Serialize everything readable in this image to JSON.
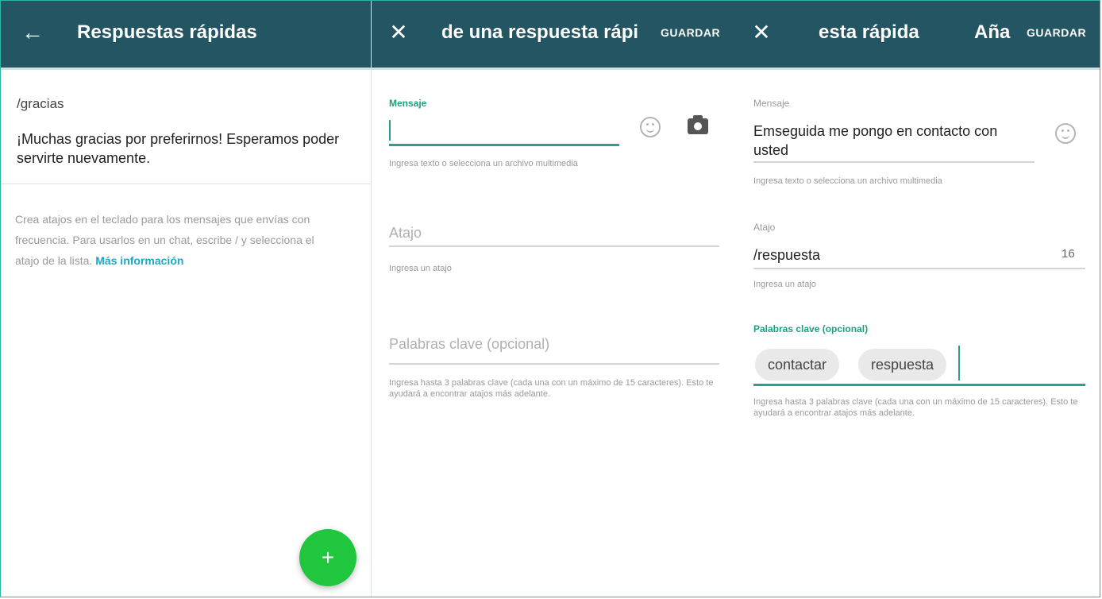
{
  "list_panel": {
    "back_icon": "arrow-left-icon",
    "title": "Respuestas rápidas",
    "item": {
      "shortcut": "/gracias",
      "message": "¡Muchas gracias por preferirnos! Esperamos poder servirte nuevamente."
    },
    "info_text": "Crea atajos en el teclado para los mensajes que envías con frecuencia. Para usarlos en un chat, escribe / y selecciona el atajo de la lista.",
    "info_link": "Más información",
    "fab_label": "+"
  },
  "add_panel": {
    "close_icon": "close-icon",
    "title": "de una respuesta rápi",
    "save_label": "GUARDAR",
    "message_label": "Mensaje",
    "message_helper": "Ingresa texto o selecciona un archivo multimedia",
    "shortcut_placeholder": "Atajo",
    "shortcut_helper": "Ingresa un atajo",
    "keywords_placeholder": "Palabras clave (opcional)",
    "keywords_helper": "Ingresa hasta 3 palabras clave (cada una con un máximo de 15 caracteres). Esto te ayudará a encontrar atajos más adelante."
  },
  "edit_panel": {
    "close_icon": "close-icon",
    "title": "esta rápida",
    "title_extra": "Aña",
    "save_label": "GUARDAR",
    "message_label": "Mensaje",
    "message_value": "Emseguida me pongo en contacto con usted",
    "message_helper": "Ingresa texto o selecciona un archivo multimedia",
    "shortcut_label": "Atajo",
    "shortcut_value": "respuesta",
    "shortcut_counter": "16",
    "shortcut_helper": "Ingresa un atajo",
    "keywords_label": "Palabras clave (opcional)",
    "keywords": [
      "contactar",
      "respuesta"
    ],
    "keywords_helper": "Ingresa hasta 3 palabras clave (cada una con un máximo de 15 caracteres). Esto te ayudará a encontrar atajos más adelante."
  },
  "colors": {
    "appbar": "#235563",
    "accent": "#2f9e8c",
    "fab": "#20c63e",
    "link": "#1ea7c4"
  }
}
